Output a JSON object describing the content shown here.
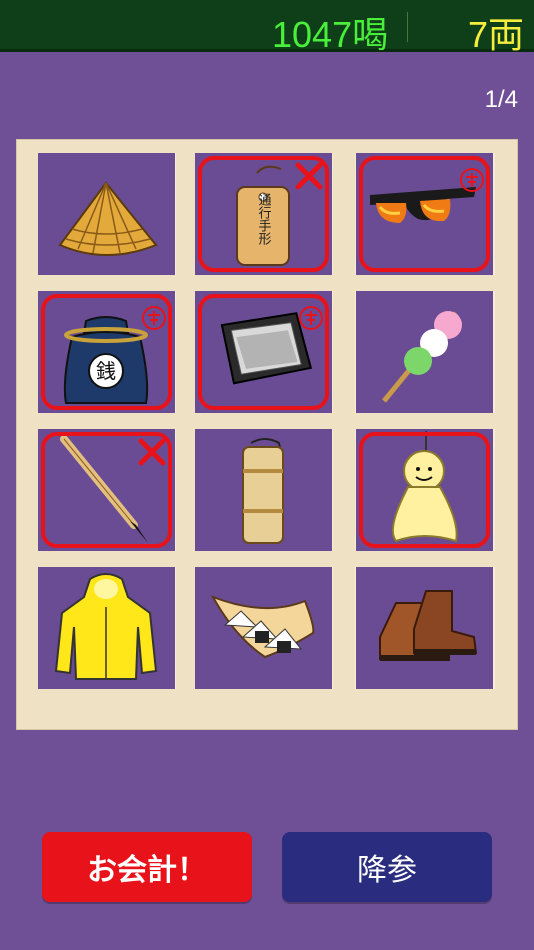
{
  "header": {
    "score": "1047喝",
    "money": "7両"
  },
  "page_indicator": "1/4",
  "items": [
    {
      "name": "straw-hat",
      "label": "",
      "selected": false,
      "mark": "none"
    },
    {
      "name": "travel-pass",
      "label": "通行手形",
      "selected": true,
      "mark": "cross"
    },
    {
      "name": "sunglasses",
      "label": "",
      "selected": true,
      "mark": "stamp"
    },
    {
      "name": "coin-bag",
      "label": "銭",
      "selected": true,
      "mark": "stamp"
    },
    {
      "name": "frying-pan",
      "label": "",
      "selected": true,
      "mark": "stamp"
    },
    {
      "name": "dango",
      "label": "",
      "selected": false,
      "mark": "none"
    },
    {
      "name": "brush",
      "label": "",
      "selected": true,
      "mark": "cross"
    },
    {
      "name": "water-flask",
      "label": "",
      "selected": false,
      "mark": "none"
    },
    {
      "name": "teru-teru-bozu",
      "label": "",
      "selected": true,
      "mark": "none"
    },
    {
      "name": "raincoat",
      "label": "",
      "selected": false,
      "mark": "none"
    },
    {
      "name": "onigiri",
      "label": "",
      "selected": false,
      "mark": "none"
    },
    {
      "name": "boots",
      "label": "",
      "selected": false,
      "mark": "none"
    }
  ],
  "buttons": {
    "checkout": "お会計！",
    "surrender": "降参"
  },
  "colors": {
    "accent_red": "#e8121a",
    "button_blue": "#2a2d7f",
    "score_green": "#49ef3a",
    "money_yellow": "#f6ee3e"
  }
}
